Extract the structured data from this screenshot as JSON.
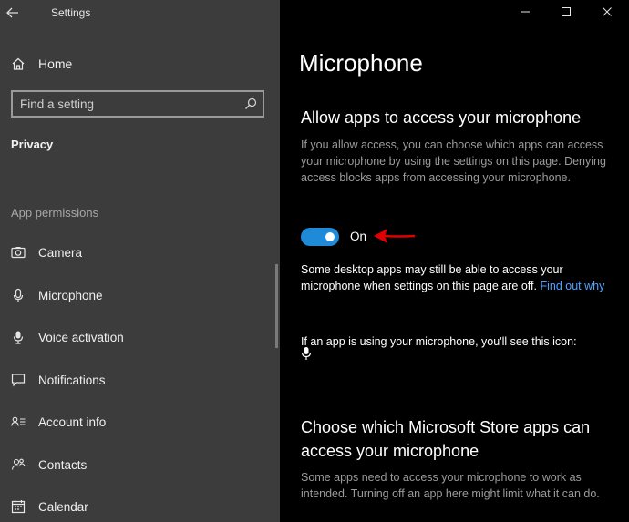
{
  "window": {
    "app_title": "Settings",
    "controls": [
      "minimize",
      "maximize",
      "close"
    ]
  },
  "sidebar": {
    "home_label": "Home",
    "search_placeholder": "Find a setting",
    "section_title": "Privacy",
    "subsection_title": "App permissions",
    "items": [
      {
        "label": "Camera",
        "icon": "camera-icon"
      },
      {
        "label": "Microphone",
        "icon": "microphone-icon"
      },
      {
        "label": "Voice activation",
        "icon": "voice-activation-icon"
      },
      {
        "label": "Notifications",
        "icon": "notifications-icon"
      },
      {
        "label": "Account info",
        "icon": "account-info-icon"
      },
      {
        "label": "Contacts",
        "icon": "contacts-icon"
      },
      {
        "label": "Calendar",
        "icon": "calendar-icon"
      }
    ]
  },
  "main": {
    "page_title": "Microphone",
    "allow_heading": "Allow apps to access your microphone",
    "allow_description": "If you allow access, you can choose which apps can access your microphone by using the settings on this page. Denying access blocks apps from accessing your microphone.",
    "toggle_state": "On",
    "desktop_note": "Some desktop apps may still be able to access your microphone when settings on this page are off.",
    "find_out_why": "Find out why",
    "icon_note": "If an app is using your microphone, you'll see this icon:",
    "store_heading": "Choose which Microsoft Store apps can access your microphone",
    "store_description": "Some apps need to access your microphone to work as intended. Turning off an app here might limit what it can do."
  },
  "colors": {
    "sidebar_bg": "#3c3c3c",
    "content_bg": "#000000",
    "accent": "#1e8ad8",
    "link": "#4da3ff",
    "annotation_arrow": "#e00000"
  }
}
